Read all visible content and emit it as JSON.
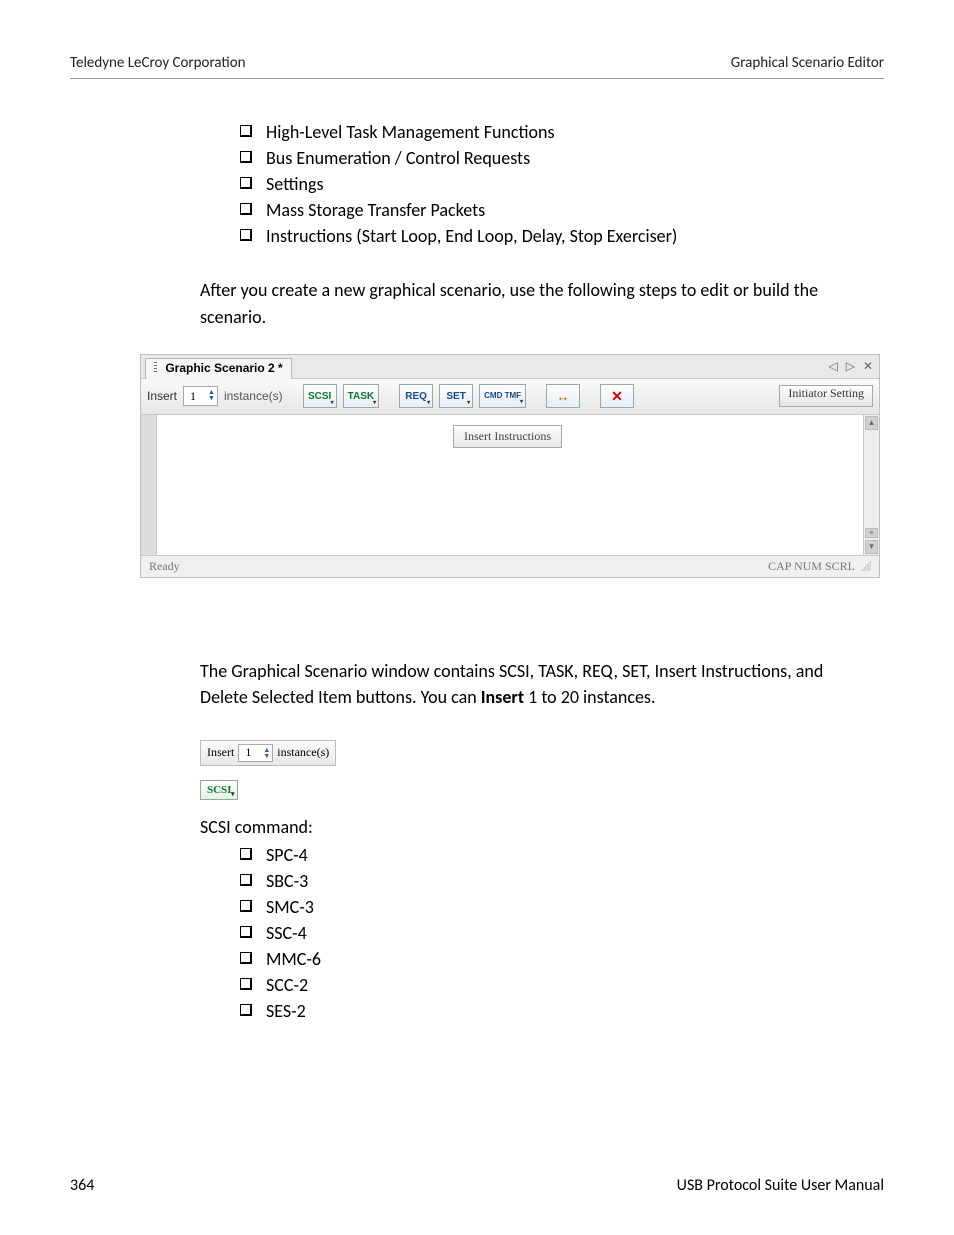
{
  "header": {
    "left": "Teledyne LeCroy Corporation",
    "right": "Graphical Scenario Editor"
  },
  "list1": {
    "items": [
      "High-Level Task Management Functions",
      "Bus Enumeration / Control Requests",
      "Settings",
      "Mass Storage Transfer Packets",
      "Instructions (Start Loop, End Loop, Delay, Stop Exerciser)"
    ]
  },
  "para1": "After you create a new graphical scenario, use the following steps to edit or build the scenario.",
  "editor": {
    "tab_title": "Graphic Scenario 2 *",
    "tab_ctrl_prev": "◁",
    "tab_ctrl_next": "▷",
    "tab_ctrl_close": "✕",
    "toolbar": {
      "insert_label": "Insert",
      "insert_value": "1",
      "instance_label": "instance(s)",
      "btn_scsi": "SCSI",
      "btn_task": "TASK",
      "btn_req": "REQ",
      "btn_set": "SET",
      "btn_cmd": "CMD\nTMF",
      "btn_instr": "↔",
      "btn_delete": "✕",
      "btn_initiator": "Initiator Setting"
    },
    "canvas": {
      "insert_pill": "Insert Instructions"
    },
    "scroll": {
      "up": "▴",
      "down": "▾"
    },
    "status": {
      "ready": "Ready",
      "indicators": "CAP NUM SCRL"
    }
  },
  "para2_a": "The Graphical Scenario window contains SCSI, TASK, REQ, SET, Insert Instructions, and Delete Selected Item buttons. You can ",
  "para2_bold": "Insert",
  "para2_b": " 1 to 20 instances.",
  "insert_ctrl": {
    "label": "Insert",
    "value": "1",
    "suffix": "instance(s)"
  },
  "scsi_chip": "SCSI",
  "scsi_label": "SCSI command:",
  "list2": {
    "items": [
      "SPC-4",
      "SBC-3",
      "SMC-3",
      "SSC-4",
      "MMC-6",
      "SCC-2",
      "SES-2"
    ]
  },
  "footer": {
    "page": "364",
    "manual": "USB Protocol Suite User Manual"
  }
}
